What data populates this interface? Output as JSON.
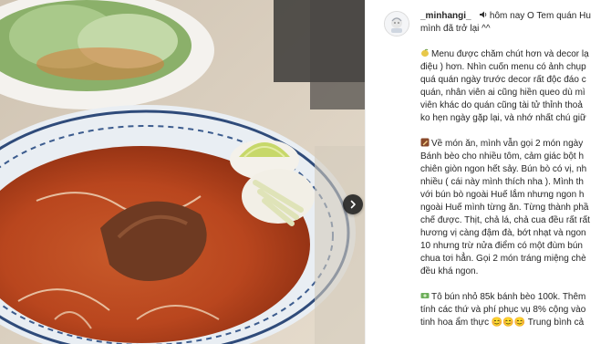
{
  "post": {
    "username": "_minhangi_",
    "header_text": "hôm nay O Tem quán Hu",
    "lines": [
      "mình đã trở lại ^^",
      "",
      "Menu được chăm chút hơn và decor lạ",
      "điệu ) hơn. Nhìn cuốn menu có ảnh chụp",
      "quá quán ngày trước decor rất độc đáo c",
      "quán, nhân viên ai cũng hiền queo dù mì",
      "viên khác do quán cũng tài tử thỉnh thoả",
      "ko hẹn ngày gặp lại, và nhớ nhất chú giữ",
      "",
      "Về món ăn, mình vẫn gọi 2 món ngày",
      "Bánh bèo cho nhiều tôm, cảm giác bột h",
      "chiên giòn ngon hết sảy. Bún bò có vị, nh",
      "nhiều ( cái này mình thích nha ). Mình th",
      "với bún bò ngoài Huế lắm nhưng ngon h",
      "ngoài Huế mình từng ăn. Từng thành phầ",
      "chế được. Thịt, chả lá, chả cua đều rất rất",
      "hương vị càng đậm đà, bớt nhạt và ngon",
      "10 nhưng trừ nửa điểm có một đùm bún",
      "chua tơi hẳn. Gọi 2 món tráng miệng chè",
      "đều khá ngon.",
      "",
      "Tô bún nhỏ 85k bánh bèo 100k. Thêm",
      "tính các thứ và phí phục vụ 8% cộng vào",
      "tinh hoa ẩm thực 😊😊😊 Trung bình cả"
    ]
  },
  "icons": {
    "header": "speaker-emoji-icon",
    "menu": "lemon-emoji-icon",
    "food": "pencil-emoji-icon",
    "price": "money-emoji-icon",
    "next": "chevron-right-icon"
  },
  "colors": {
    "text": "#262626",
    "border": "#efefef",
    "button": "#1e1e1e"
  }
}
